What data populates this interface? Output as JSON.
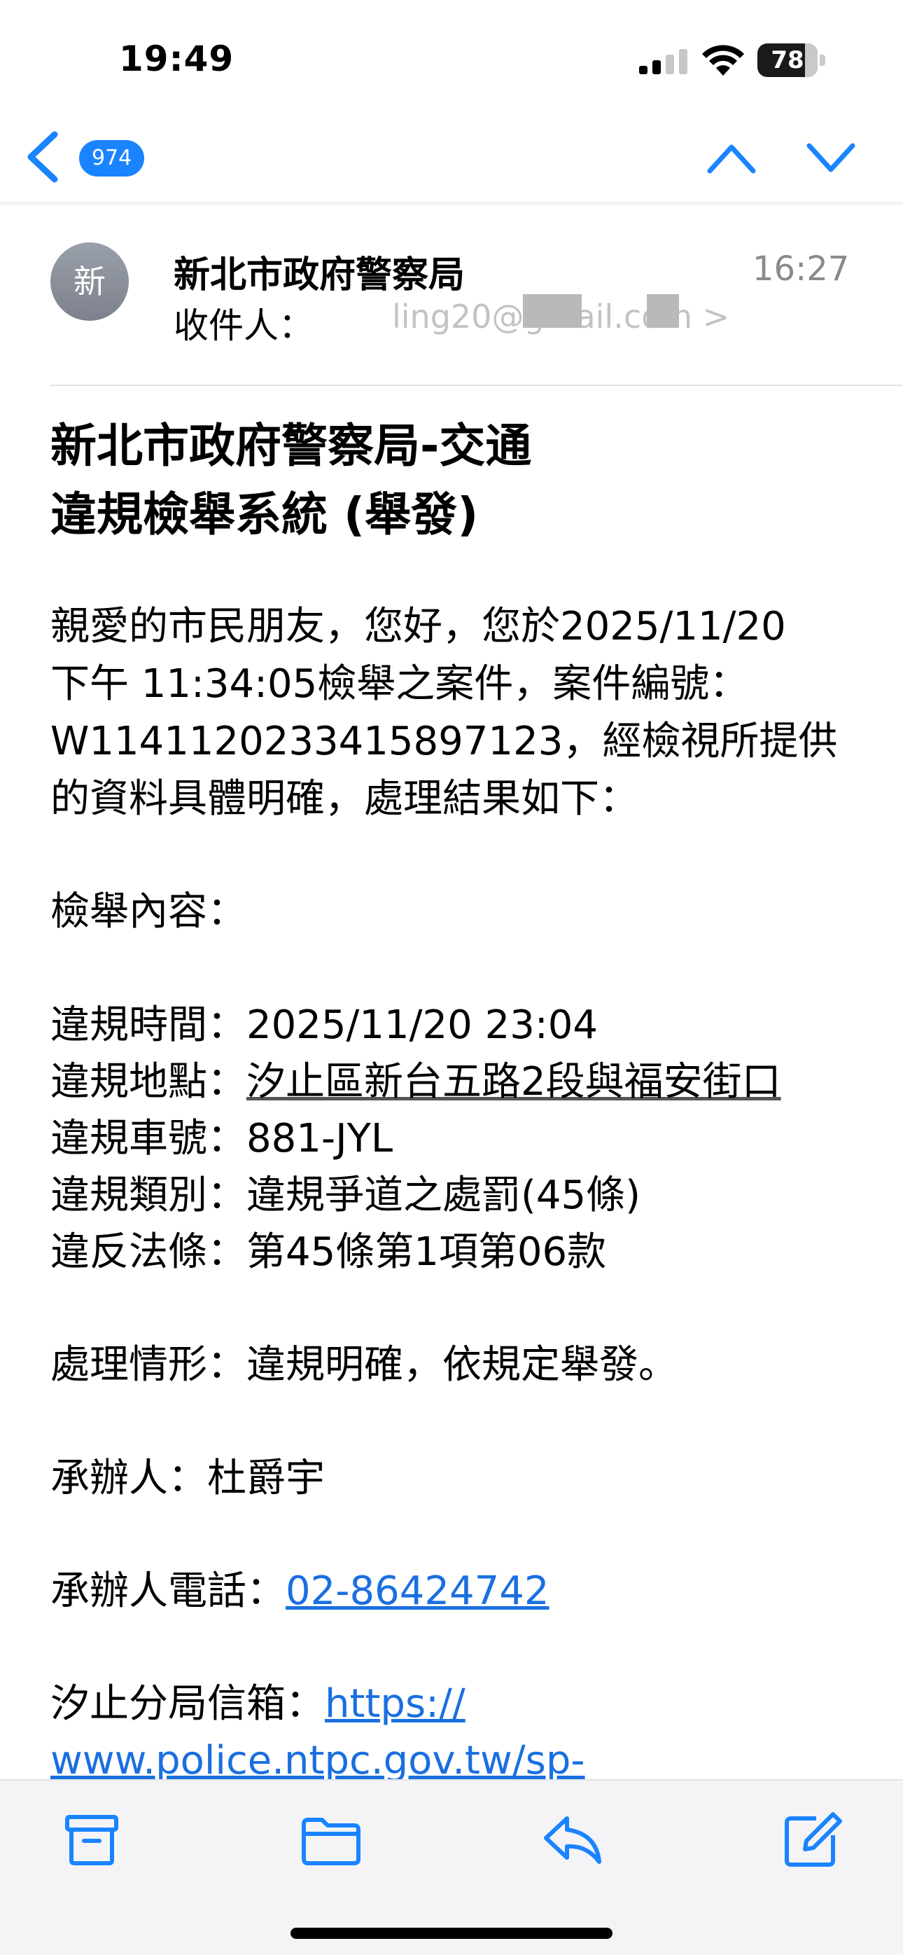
{
  "status_bar": {
    "time": "19:49",
    "battery": "78"
  },
  "nav": {
    "unread_count": "974"
  },
  "email": {
    "sender_avatar": "新",
    "sender": "新北市政府警察局",
    "time": "16:27",
    "recipient_label": "收件人：",
    "recipient_address": "ling20@gmail.com >",
    "subject_line1": "新北市政府警察局-交通",
    "subject_line2": "違規檢舉系統 (舉發)",
    "body": {
      "p1_l1": "親愛的市民朋友，您好，您於2025/11/20",
      "p1_l2": "下午 11:34:05檢舉之案件，案件編號：",
      "p1_l3": "W114112023341589712​3，經檢視所提供",
      "p1_l4": "的資料具體明確，處理結果如下：",
      "content_label": "檢舉內容：",
      "time_label": "違規時間：",
      "time_value": "2025/11/20 23:04",
      "location_label": "違規地點：",
      "location_value": "汐止區新台五路2段與福安街口",
      "plate_label": "違規車號：",
      "plate_value": "881-JYL",
      "category_label": "違規類別：",
      "category_value": "違規爭道之處罰(45條)",
      "law_label": "違反法條：",
      "law_value": "第45條第1項第06款",
      "result_label": "處理情形：",
      "result_value": "違規明確，依規定舉發。",
      "handler_label": "承辦人：",
      "handler_value": "杜爵宇",
      "phone_label": "承辦人電話：",
      "phone_value": "02-86424742",
      "mailbox_label": "汐止分局信箱：",
      "mailbox_link_l1": "https://",
      "mailbox_link_l2": "www.police.ntpc.gov.tw/sp-"
    }
  },
  "toolbar": {
    "icons": [
      "archive-icon",
      "folder-icon",
      "reply-icon",
      "compose-icon"
    ]
  },
  "colors": {
    "accent": "#1a84ff",
    "link": "#1a6fe0",
    "toolbar_bg": "#f4f4f6"
  }
}
